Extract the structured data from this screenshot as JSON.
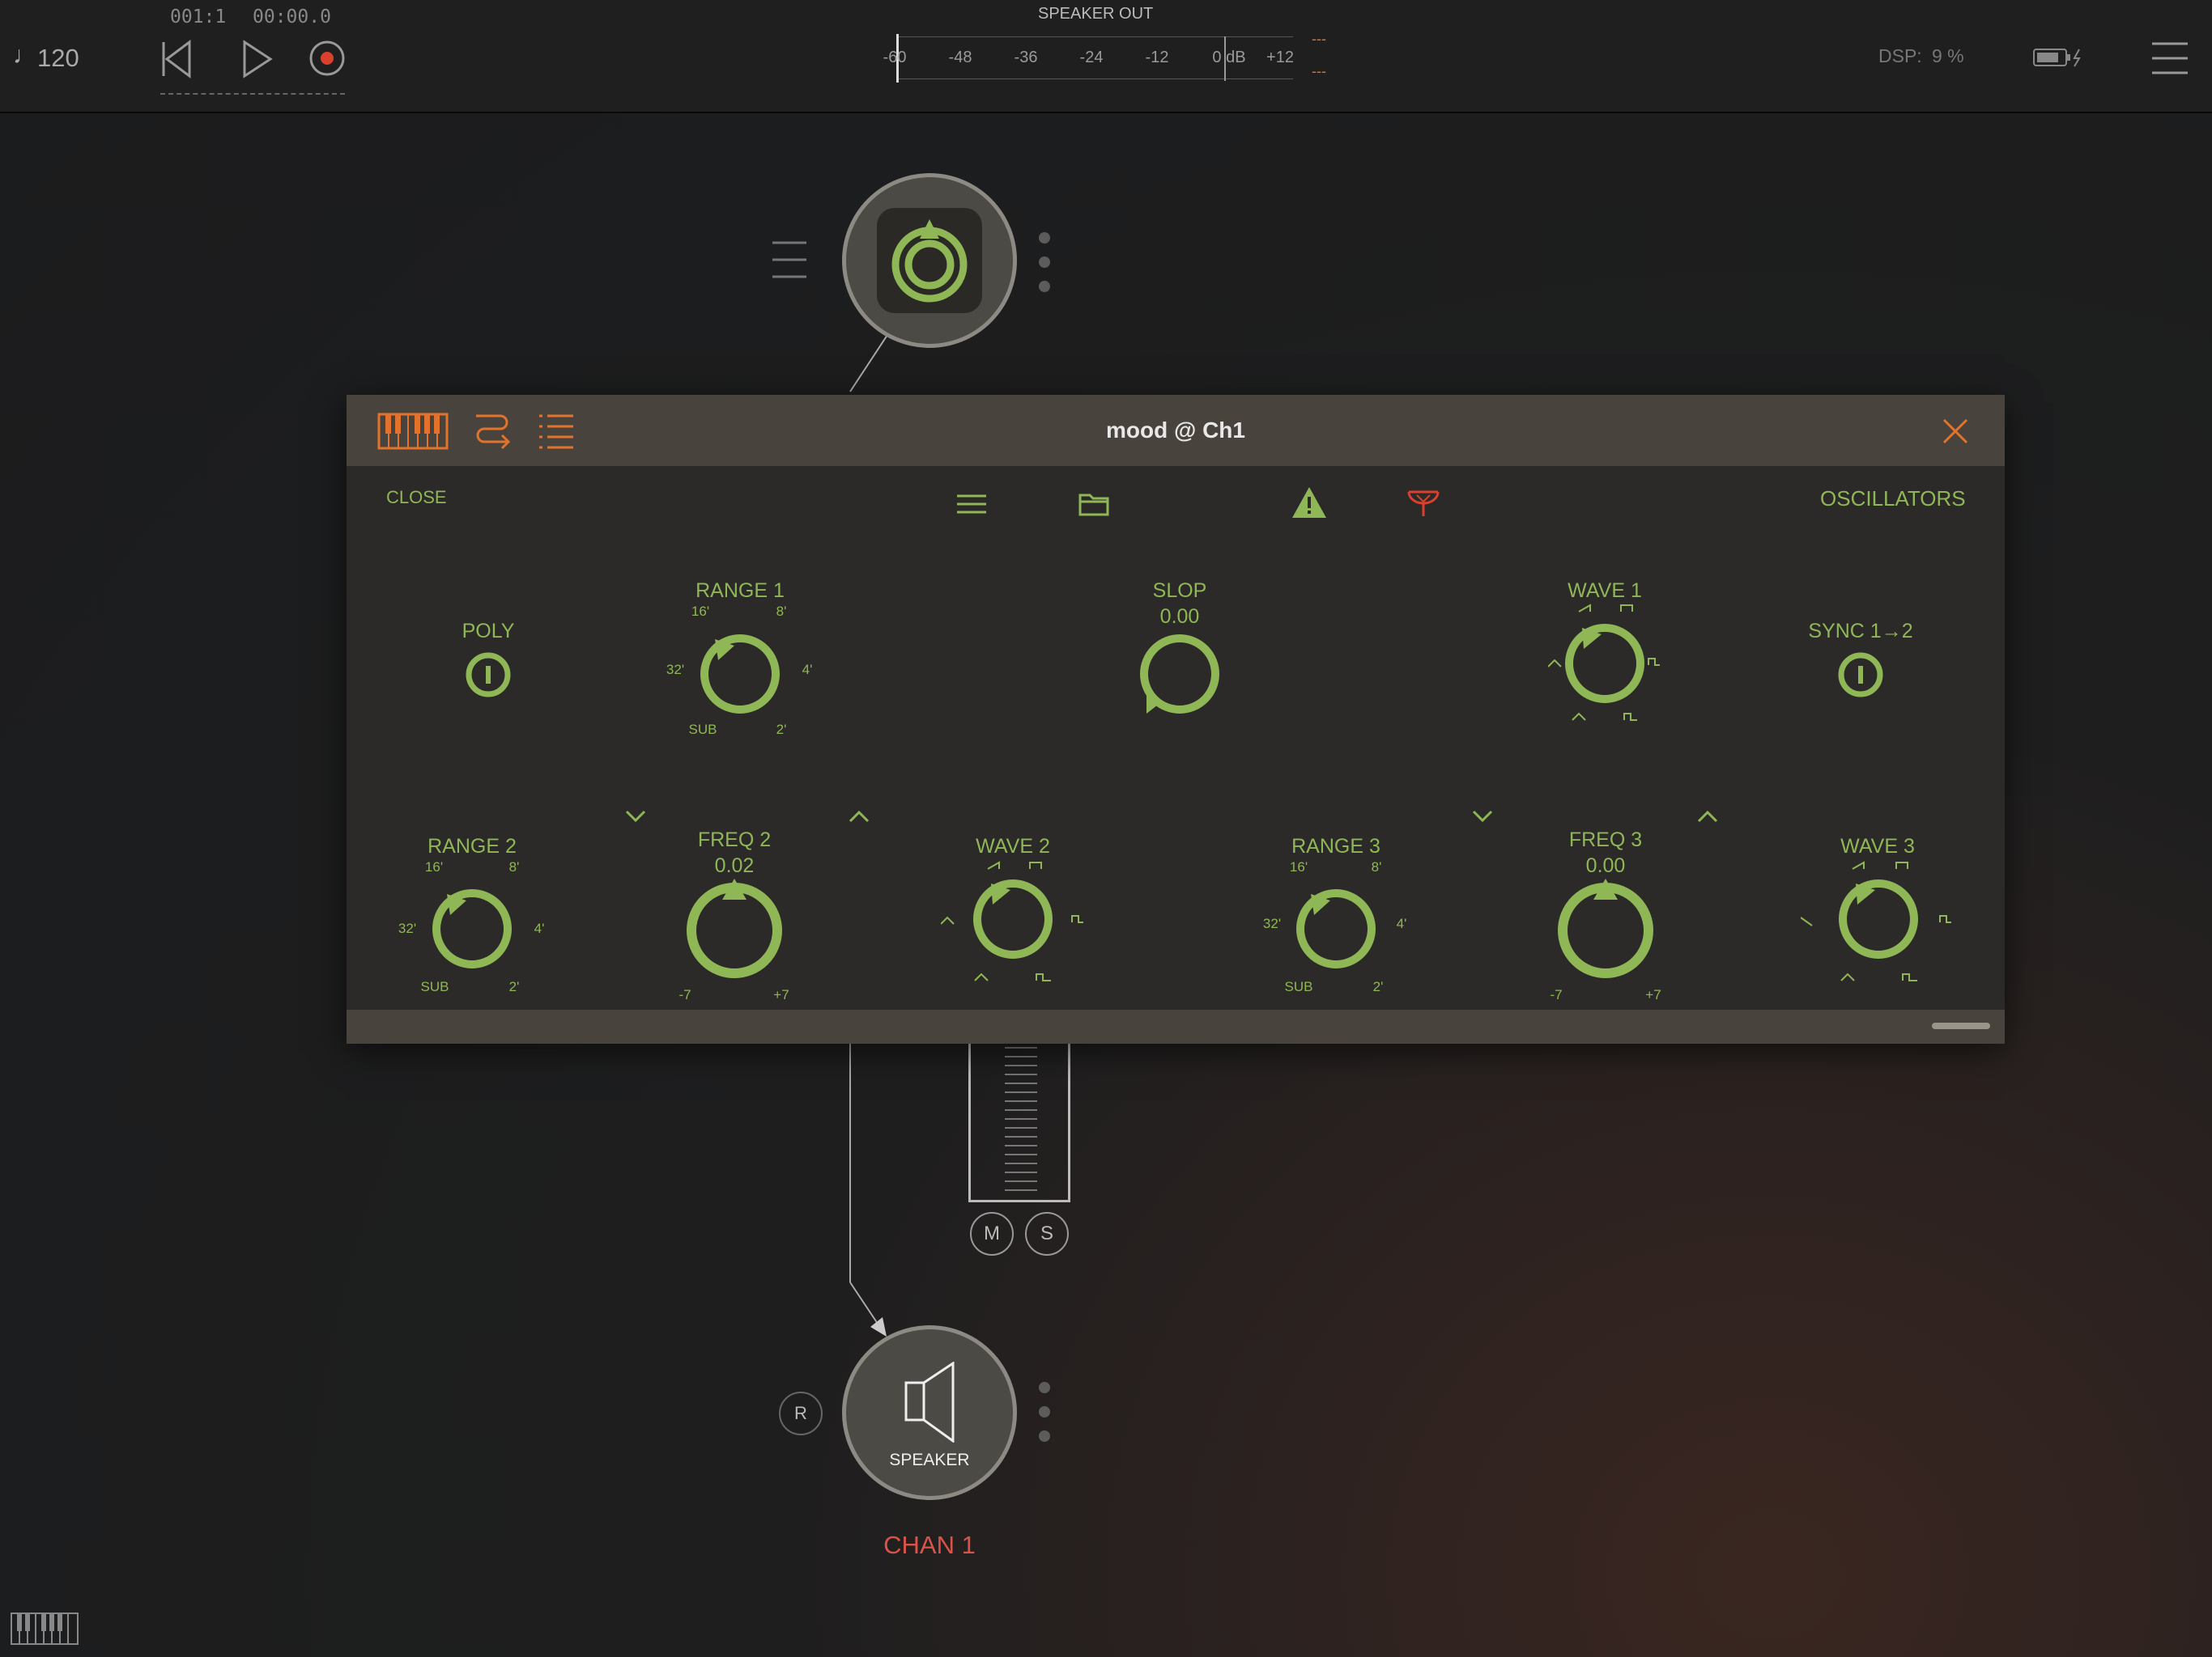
{
  "topbar": {
    "tempo": "120",
    "position_bars": "001:1",
    "position_time": "00:00.0",
    "meter_title": "SPEAKER OUT",
    "meter_scale": [
      "-60",
      "-48",
      "-36",
      "-24",
      "-12",
      "0 dB",
      "+12"
    ],
    "meter_peak_l": "---",
    "meter_peak_r": "---",
    "dsp_label": "DSP:",
    "dsp_value": "9 %"
  },
  "graph": {
    "speaker_label": "SPEAKER",
    "channel_label": "CHAN 1",
    "mute_label": "M",
    "solo_label": "S",
    "record_label": "R"
  },
  "panel": {
    "title": "mood @ Ch1",
    "close_label": "CLOSE",
    "page_label": "OSCILLATORS",
    "poly": {
      "label": "POLY"
    },
    "sync": {
      "label": "SYNC 1→2"
    },
    "range1": {
      "label": "RANGE 1",
      "marks": [
        "16'",
        "8'",
        "32'",
        "4'",
        "SUB",
        "2'"
      ]
    },
    "slop": {
      "label": "SLOP",
      "value": "0.00"
    },
    "wave1": {
      "label": "WAVE 1"
    },
    "range2": {
      "label": "RANGE 2",
      "marks": [
        "16'",
        "8'",
        "32'",
        "4'",
        "SUB",
        "2'"
      ]
    },
    "freq2": {
      "label": "FREQ 2",
      "value": "0.02",
      "min": "-7",
      "max": "+7"
    },
    "wave2": {
      "label": "WAVE 2"
    },
    "range3": {
      "label": "RANGE 3",
      "marks": [
        "16'",
        "8'",
        "32'",
        "4'",
        "SUB",
        "2'"
      ]
    },
    "freq3": {
      "label": "FREQ 3",
      "value": "0.00",
      "min": "-7",
      "max": "+7"
    },
    "wave3": {
      "label": "WAVE 3"
    }
  },
  "colors": {
    "accent_green": "#8fb756",
    "accent_orange": "#e3732c",
    "alert_red": "#d9412e",
    "channel_red": "#d9534a"
  },
  "icons": [
    "note-icon",
    "rewind-icon",
    "play-icon",
    "record-icon",
    "battery-icon",
    "menu-icon",
    "piano-icon",
    "routing-icon",
    "list-icon",
    "close-x-icon",
    "hamburger-icon",
    "folder-icon",
    "warning-icon",
    "midi-icon",
    "speaker-icon",
    "keyboard-icon"
  ]
}
